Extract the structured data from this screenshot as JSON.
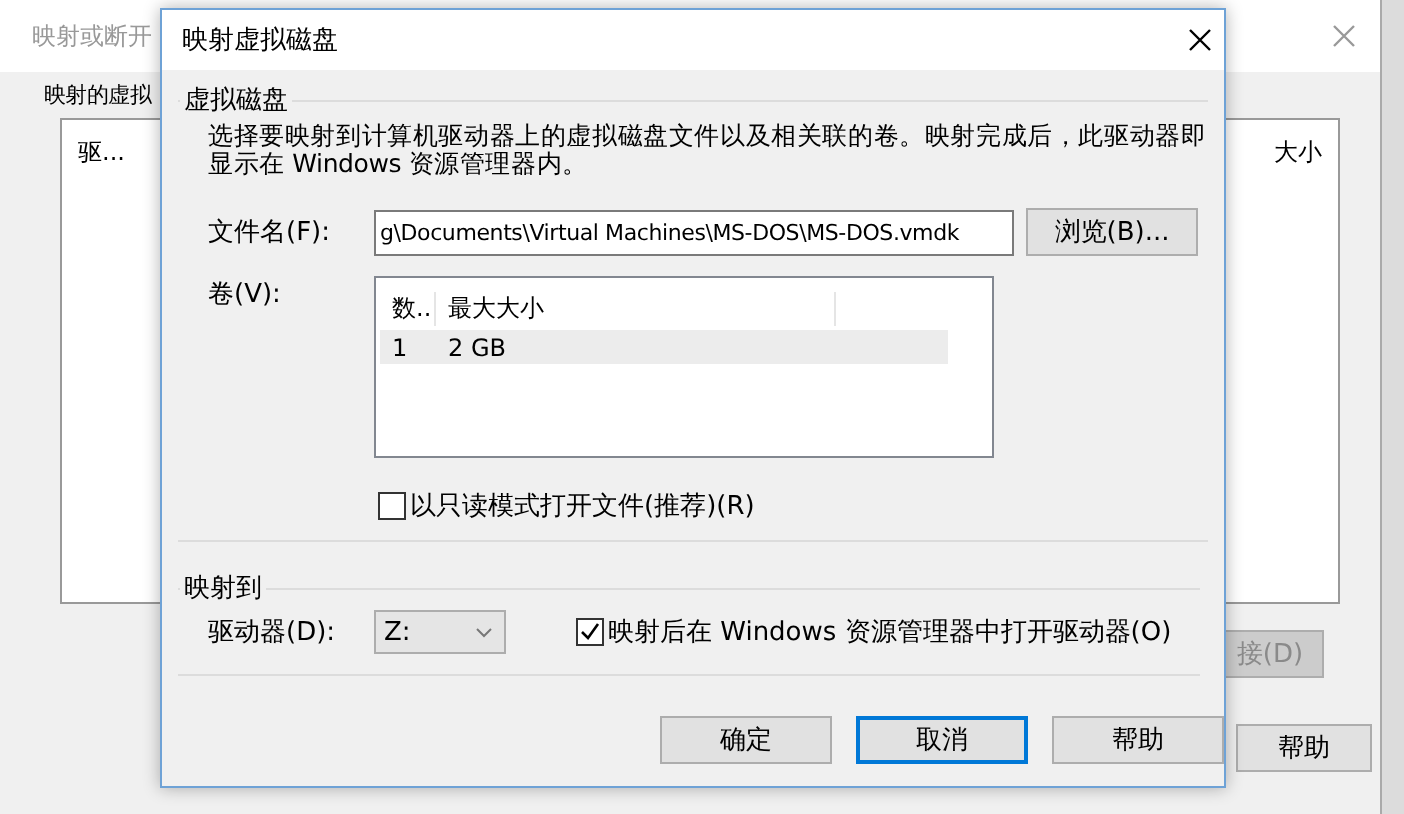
{
  "background_window": {
    "title": "映射或断开",
    "group_label": "映射的虚拟",
    "columns": [
      "驱...",
      "大小"
    ],
    "buttons": [
      {
        "label": "接(D)",
        "disabled": true
      },
      {
        "label": "帮助",
        "disabled": false
      }
    ]
  },
  "dialog": {
    "title": "映射虚拟磁盘",
    "virtual_disk": {
      "label": "虚拟磁盘",
      "description": "选择要映射到计算机驱动器上的虚拟磁盘文件以及相关联的卷。映射完成后，此驱动器即显示在 Windows 资源管理器内。",
      "file_label": "文件名(F):",
      "file_value": "g\\Documents\\Virtual Machines\\MS-DOS\\MS-DOS.vmdk",
      "browse_button": "浏览(B)...",
      "volume_label": "卷(V):",
      "volume_columns": [
        "数..",
        "最大大小"
      ],
      "volume_rows": [
        {
          "cells": [
            "1",
            "2 GB"
          ],
          "selected": true
        }
      ],
      "readonly_checkbox": {
        "label": "以只读模式打开文件(推荐)(R)",
        "checked": false
      }
    },
    "map_to": {
      "label": "映射到",
      "drive_label": "驱动器(D):",
      "drive_value": "Z:",
      "open_checkbox": {
        "label": "映射后在 Windows 资源管理器中打开驱动器(O)",
        "checked": true
      }
    },
    "buttons": [
      {
        "label": "确定",
        "focused": false
      },
      {
        "label": "取消",
        "focused": true
      },
      {
        "label": "帮助",
        "focused": false
      }
    ]
  }
}
